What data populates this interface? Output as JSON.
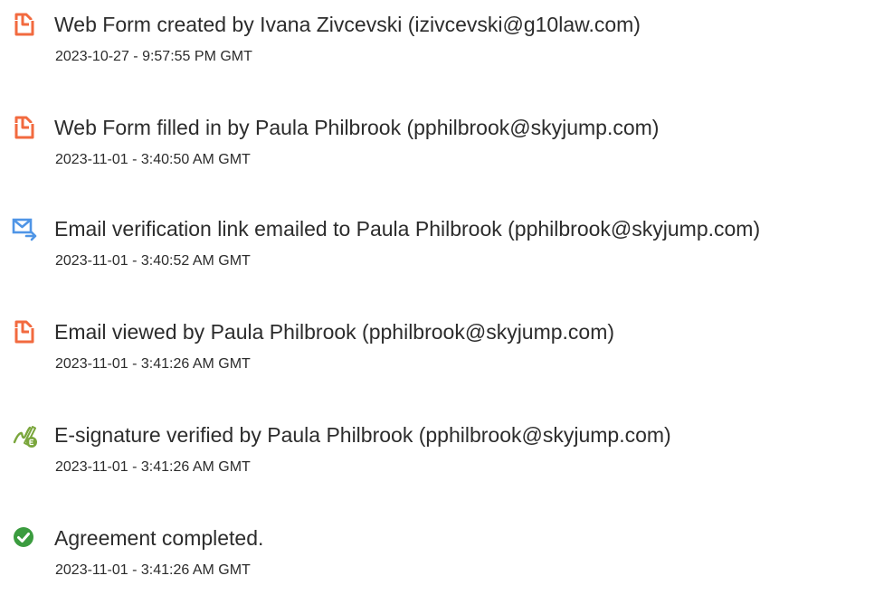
{
  "colors": {
    "document_icon": "#f26a3f",
    "email_icon": "#4f95e6",
    "signature_icon": "#7aa63c",
    "check_icon": "#3b9c3f"
  },
  "events": [
    {
      "icon": "document-icon",
      "text": "Web Form created by Ivana Zivcevski (izivcevski@g10law.com)",
      "timestamp": "2023-10-27 - 9:57:55 PM GMT"
    },
    {
      "icon": "document-icon",
      "text": "Web Form filled in by Paula Philbrook (pphilbrook@skyjump.com)",
      "timestamp": "2023-11-01 - 3:40:50 AM GMT"
    },
    {
      "icon": "email-icon",
      "text": "Email verification link emailed to Paula Philbrook (pphilbrook@skyjump.com)",
      "timestamp": "2023-11-01 - 3:40:52 AM GMT"
    },
    {
      "icon": "document-icon",
      "text": "Email viewed by Paula Philbrook (pphilbrook@skyjump.com)",
      "timestamp": "2023-11-01 - 3:41:26 AM GMT"
    },
    {
      "icon": "signature-icon",
      "text": "E-signature verified by Paula Philbrook (pphilbrook@skyjump.com)",
      "timestamp": "2023-11-01 - 3:41:26 AM GMT"
    },
    {
      "icon": "check-circle-icon",
      "text": "Agreement completed.",
      "timestamp": "2023-11-01 - 3:41:26 AM GMT"
    }
  ]
}
